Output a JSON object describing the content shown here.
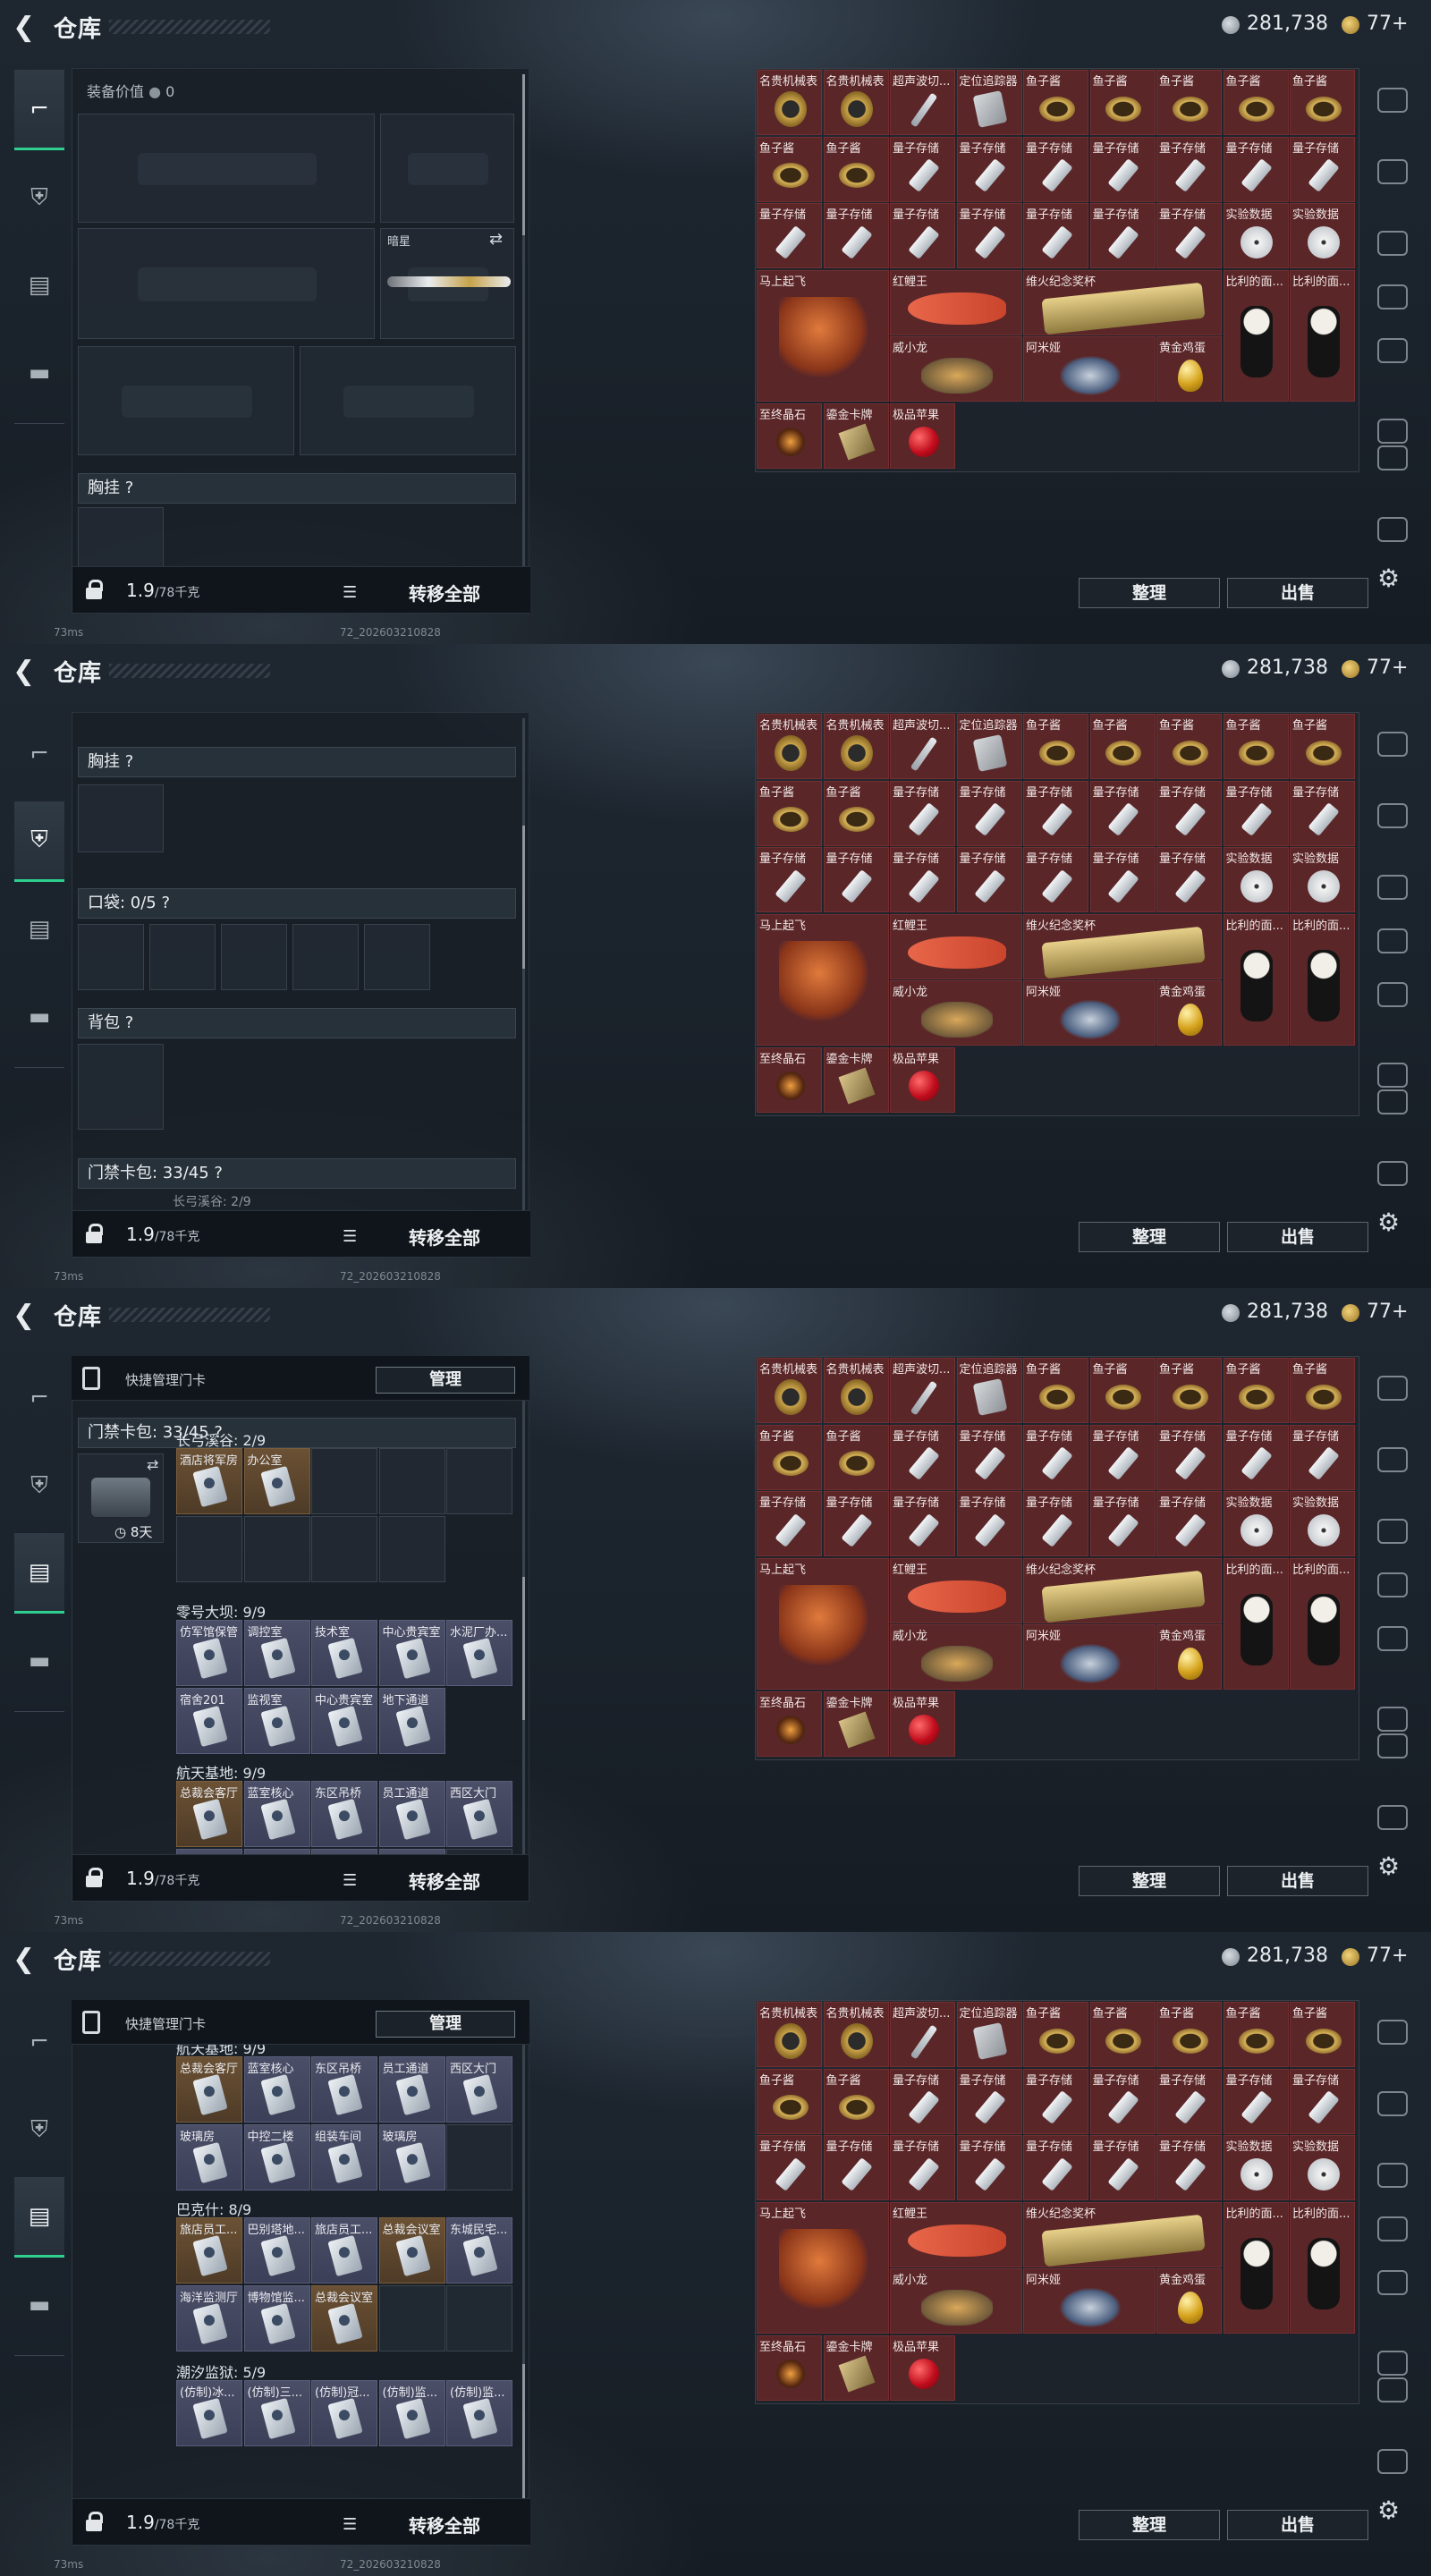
{
  "header": {
    "title": "仓库",
    "silver": "281,738",
    "gold": "77+"
  },
  "sidebar": {
    "tabs": [
      "weapon-tab",
      "armor-tab",
      "keycard-tab",
      "case-tab"
    ]
  },
  "footer": {
    "ping": "73ms",
    "build": "72_202603210828"
  },
  "loadout": {
    "weight": "1.9",
    "capacity": "/78千克",
    "move_all": "转移全部",
    "equipment_value_label": "装备价值",
    "equipment_value": "0",
    "slot_label_darkstar": "暗星",
    "chest_rig": "胸挂 ?",
    "pockets": "口袋: 0/5 ?",
    "backpack": "背包 ?",
    "keycard_pack": "门禁卡包: 33/45 ?",
    "longbow_peek": "长弓溪谷: 2/9"
  },
  "manage": {
    "label": "快捷管理门卡",
    "button": "管理"
  },
  "keycards": {
    "pack_title": "门禁卡包: 33/45 ?",
    "duration": "8天",
    "sections": [
      {
        "title": "长弓溪谷: 2/9",
        "cards": [
          "酒店将军房",
          "办公室"
        ]
      },
      {
        "title": "零号大坝: 9/9",
        "cards": [
          "仿军馆保管",
          "调控室",
          "技术室",
          "中心贵宾室",
          "水泥厂办...",
          "宿舍201",
          "监视室",
          "中心贵宾室",
          "地下通道"
        ]
      },
      {
        "title": "航天基地: 9/9",
        "cards": [
          "总裁会客厅",
          "蓝室核心",
          "东区吊桥",
          "员工通道",
          "西区大门",
          "玻璃房",
          "中控二楼",
          "组装车间",
          "玻璃房"
        ]
      },
      {
        "title": "巴克什: 8/9",
        "cards": [
          "旅店员工...",
          "巴别塔地...",
          "旅店员工...",
          "总裁会议室",
          "东城民宅...",
          "海洋监测厅",
          "博物馆监...",
          "总裁会议室"
        ]
      },
      {
        "title": "潮汐监狱: 5/9",
        "cards": [
          "(仿制)冰...",
          "(仿制)三...",
          "(仿制)冠...",
          "(仿制)监...",
          "(仿制)监..."
        ]
      }
    ]
  },
  "stash": {
    "sort_button": "整理",
    "sell_button": "出售",
    "items": [
      "名贵机械表",
      "名贵机械表",
      "超声波切...",
      "定位追踪器",
      "鱼子酱",
      "鱼子酱",
      "鱼子酱",
      "鱼子酱",
      "鱼子酱",
      "鱼子酱",
      "鱼子酱",
      "量子存储",
      "量子存储",
      "量子存储",
      "量子存储",
      "量子存储",
      "量子存储",
      "量子存储",
      "量子存储",
      "量子存储",
      "量子存储",
      "量子存储",
      "量子存储",
      "量子存储",
      "量子存储",
      "实验数据",
      "实验数据",
      "马上起飞",
      "红鲤王",
      "维火纪念奖杯",
      "比利的面...",
      "比利的面...",
      "威小龙",
      "阿米娅",
      "黄金鸡蛋",
      "至终晶石",
      "鎏金卡牌",
      "极品苹果"
    ]
  },
  "colors": {
    "accent": "#2fcf8f",
    "red_item": "#5a2628",
    "gold_card": "#6b5134",
    "purple_card": "#4b4e67"
  }
}
